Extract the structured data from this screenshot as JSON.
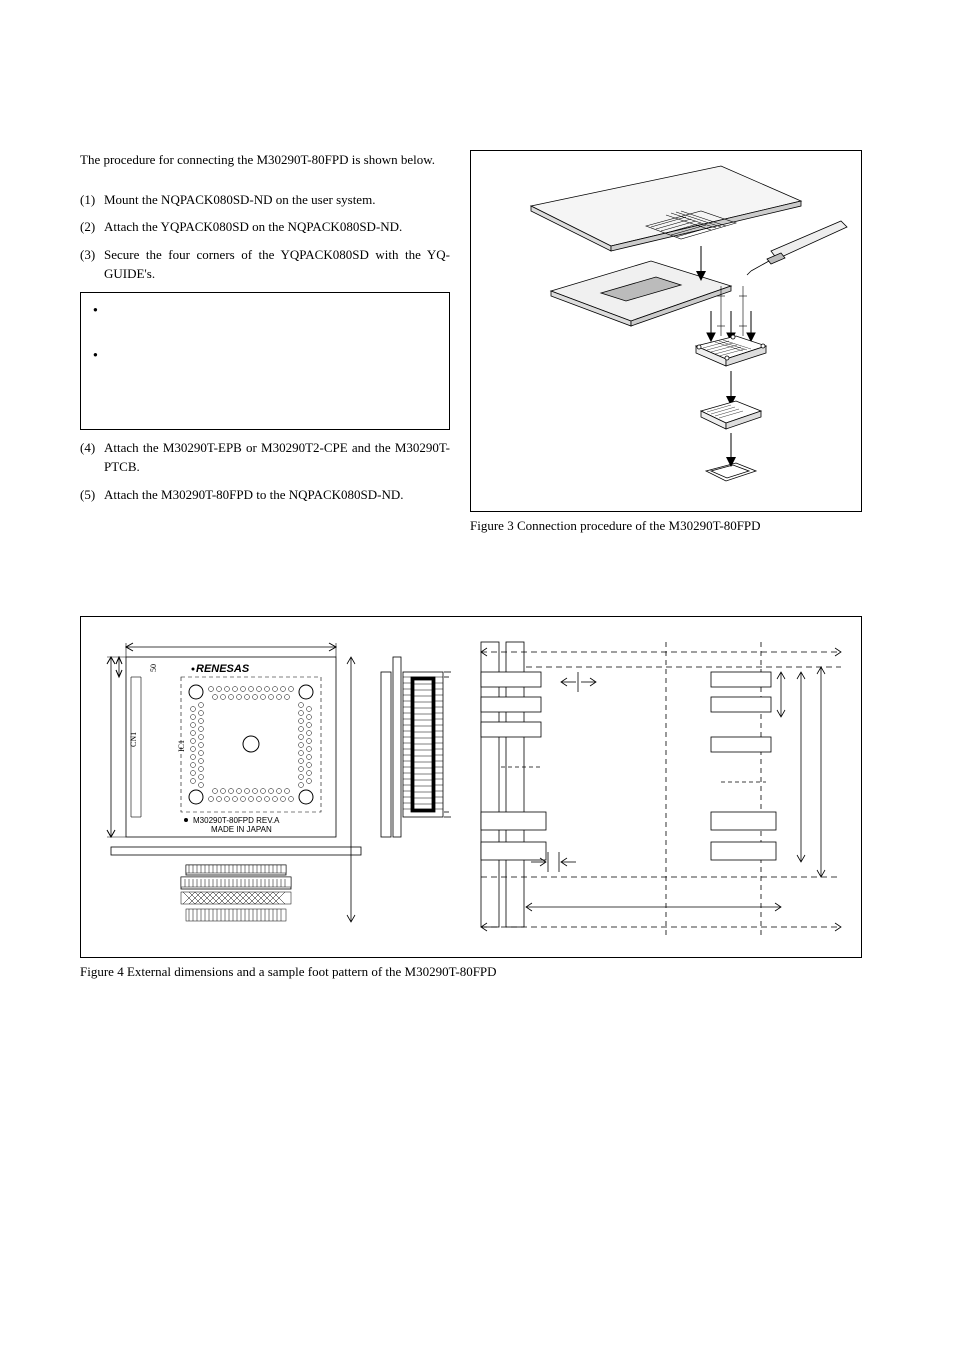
{
  "intro": "The procedure for connecting the M30290T-80FPD is shown below.",
  "steps": [
    {
      "n": "(1)",
      "t": "Mount the NQPACK080SD-ND on the user system."
    },
    {
      "n": "(2)",
      "t": "Attach the YQPACK080SD on the NQPACK080SD-ND."
    },
    {
      "n": "(3)",
      "t": "Secure the four corners of the YQPACK080SD with the YQ-GUIDE's."
    }
  ],
  "steps_after": [
    {
      "n": "(4)",
      "t": "Attach the M30290T-EPB or M30290T2-CPE and the M30290T-PTCB."
    },
    {
      "n": "(5)",
      "t": "Attach the M30290T-80FPD to the NQPACK080SD-ND."
    }
  ],
  "fig3_caption": "Figure 3 Connection procedure of the M30290T-80FPD",
  "fig4_caption": "Figure 4 External dimensions and a sample foot pattern of the M30290T-80FPD",
  "board_label1": "M30290T-80FPD REV.A",
  "board_label2": "MADE IN JAPAN",
  "brand": "RENESAS",
  "cn1": "CN1",
  "ic1": "IC1",
  "fifty": "50"
}
